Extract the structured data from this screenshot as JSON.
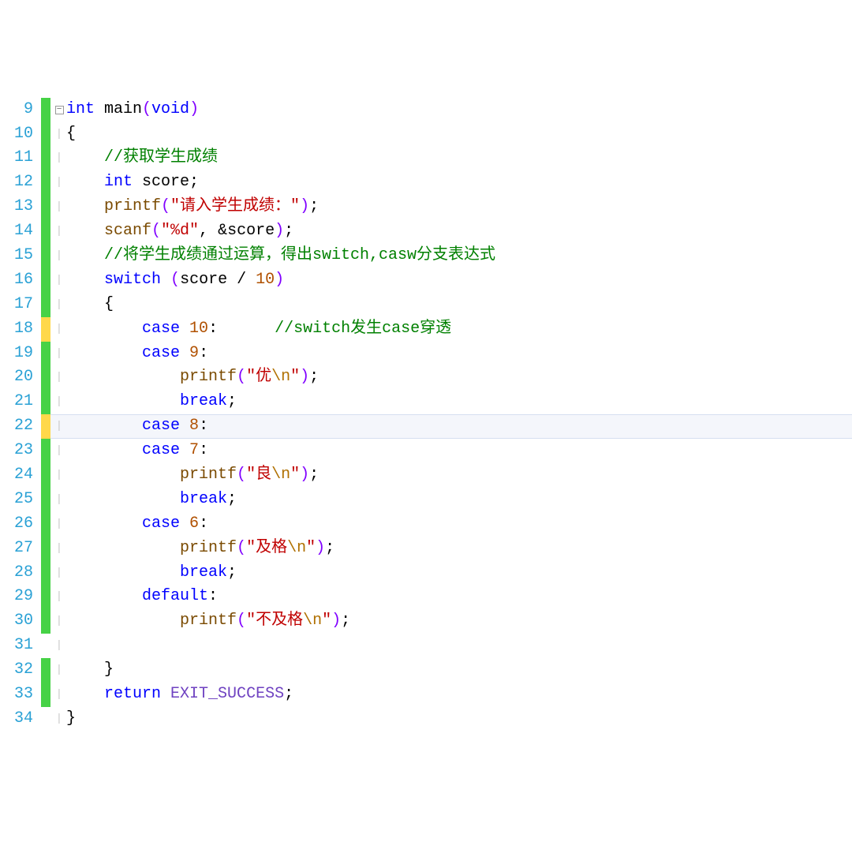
{
  "startLine": 9,
  "highlightLine": 22,
  "markers": [
    {
      "line": 9,
      "color": "green",
      "fold": "minus"
    },
    {
      "line": 10,
      "color": "green"
    },
    {
      "line": 11,
      "color": "green"
    },
    {
      "line": 12,
      "color": "green"
    },
    {
      "line": 13,
      "color": "green"
    },
    {
      "line": 14,
      "color": "green"
    },
    {
      "line": 15,
      "color": "green"
    },
    {
      "line": 16,
      "color": "green",
      "fold": "minus",
      "foldIndent": true
    },
    {
      "line": 17,
      "color": "green"
    },
    {
      "line": 18,
      "color": "yellow"
    },
    {
      "line": 19,
      "color": "green"
    },
    {
      "line": 20,
      "color": "green"
    },
    {
      "line": 21,
      "color": "green"
    },
    {
      "line": 22,
      "color": "yellow"
    },
    {
      "line": 23,
      "color": "green"
    },
    {
      "line": 24,
      "color": "green"
    },
    {
      "line": 25,
      "color": "green"
    },
    {
      "line": 26,
      "color": "green"
    },
    {
      "line": 27,
      "color": "green"
    },
    {
      "line": 28,
      "color": "green"
    },
    {
      "line": 29,
      "color": "green"
    },
    {
      "line": 30,
      "color": "green"
    },
    {
      "line": 32,
      "color": "green"
    },
    {
      "line": 33,
      "color": "green"
    }
  ],
  "tokens": {
    "l9": [
      {
        "t": "int ",
        "c": "type"
      },
      {
        "t": "main",
        "c": "identdark"
      },
      {
        "t": "(",
        "c": "paren"
      },
      {
        "t": "void",
        "c": "type"
      },
      {
        "t": ")",
        "c": "paren"
      }
    ],
    "l10": [
      {
        "t": "{",
        "c": "black"
      }
    ],
    "l11": [
      {
        "t": "    ",
        "c": ""
      },
      {
        "t": "//获取学生成绩",
        "c": "cmt"
      }
    ],
    "l12": [
      {
        "t": "    ",
        "c": ""
      },
      {
        "t": "int ",
        "c": "type"
      },
      {
        "t": "score",
        "c": "identdark"
      },
      {
        "t": ";",
        "c": "black"
      }
    ],
    "l13": [
      {
        "t": "    ",
        "c": ""
      },
      {
        "t": "printf",
        "c": "ident"
      },
      {
        "t": "(",
        "c": "paren"
      },
      {
        "t": "\"请入学生成绩：\"",
        "c": "str"
      },
      {
        "t": ")",
        "c": "paren"
      },
      {
        "t": ";",
        "c": "black"
      }
    ],
    "l14": [
      {
        "t": "    ",
        "c": ""
      },
      {
        "t": "scanf",
        "c": "ident"
      },
      {
        "t": "(",
        "c": "paren"
      },
      {
        "t": "\"%d\"",
        "c": "str"
      },
      {
        "t": ", &",
        "c": "black"
      },
      {
        "t": "score",
        "c": "identdark"
      },
      {
        "t": ")",
        "c": "paren"
      },
      {
        "t": ";",
        "c": "black"
      }
    ],
    "l15": [
      {
        "t": "    ",
        "c": ""
      },
      {
        "t": "//将学生成绩通过运算，得出switch,casw分支表达式",
        "c": "cmt"
      }
    ],
    "l16": [
      {
        "t": "    ",
        "c": ""
      },
      {
        "t": "switch",
        "c": "kw"
      },
      {
        "t": " ",
        "c": ""
      },
      {
        "t": "(",
        "c": "paren"
      },
      {
        "t": "score ",
        "c": "identdark"
      },
      {
        "t": "/",
        "c": "black"
      },
      {
        "t": " ",
        "c": ""
      },
      {
        "t": "10",
        "c": "num"
      },
      {
        "t": ")",
        "c": "paren"
      }
    ],
    "l17": [
      {
        "t": "    {",
        "c": "black"
      }
    ],
    "l18": [
      {
        "t": "        ",
        "c": ""
      },
      {
        "t": "case",
        "c": "kw"
      },
      {
        "t": " ",
        "c": ""
      },
      {
        "t": "10",
        "c": "num"
      },
      {
        "t": ":",
        "c": "black"
      },
      {
        "t": "      ",
        "c": ""
      },
      {
        "t": "//switch发生case穿透",
        "c": "cmt"
      }
    ],
    "l19": [
      {
        "t": "        ",
        "c": ""
      },
      {
        "t": "case",
        "c": "kw"
      },
      {
        "t": " ",
        "c": ""
      },
      {
        "t": "9",
        "c": "num"
      },
      {
        "t": ":",
        "c": "black"
      }
    ],
    "l20": [
      {
        "t": "            ",
        "c": ""
      },
      {
        "t": "printf",
        "c": "ident"
      },
      {
        "t": "(",
        "c": "paren"
      },
      {
        "t": "\"优",
        "c": "str"
      },
      {
        "t": "\\n",
        "c": "esc"
      },
      {
        "t": "\"",
        "c": "str"
      },
      {
        "t": ")",
        "c": "paren"
      },
      {
        "t": ";",
        "c": "black"
      }
    ],
    "l21": [
      {
        "t": "            ",
        "c": ""
      },
      {
        "t": "break",
        "c": "kw"
      },
      {
        "t": ";",
        "c": "black"
      }
    ],
    "l22": [
      {
        "t": "        ",
        "c": ""
      },
      {
        "t": "case",
        "c": "kw"
      },
      {
        "t": " ",
        "c": ""
      },
      {
        "t": "8",
        "c": "num"
      },
      {
        "t": ":",
        "c": "black"
      }
    ],
    "l23": [
      {
        "t": "        ",
        "c": ""
      },
      {
        "t": "case",
        "c": "kw"
      },
      {
        "t": " ",
        "c": ""
      },
      {
        "t": "7",
        "c": "num"
      },
      {
        "t": ":",
        "c": "black"
      }
    ],
    "l24": [
      {
        "t": "            ",
        "c": ""
      },
      {
        "t": "printf",
        "c": "ident"
      },
      {
        "t": "(",
        "c": "paren"
      },
      {
        "t": "\"良",
        "c": "str"
      },
      {
        "t": "\\n",
        "c": "esc"
      },
      {
        "t": "\"",
        "c": "str"
      },
      {
        "t": ")",
        "c": "paren"
      },
      {
        "t": ";",
        "c": "black"
      }
    ],
    "l25": [
      {
        "t": "            ",
        "c": ""
      },
      {
        "t": "break",
        "c": "kw"
      },
      {
        "t": ";",
        "c": "black"
      }
    ],
    "l26": [
      {
        "t": "        ",
        "c": ""
      },
      {
        "t": "case",
        "c": "kw"
      },
      {
        "t": " ",
        "c": ""
      },
      {
        "t": "6",
        "c": "num"
      },
      {
        "t": ":",
        "c": "black"
      }
    ],
    "l27": [
      {
        "t": "            ",
        "c": ""
      },
      {
        "t": "printf",
        "c": "ident"
      },
      {
        "t": "(",
        "c": "paren"
      },
      {
        "t": "\"及格",
        "c": "str"
      },
      {
        "t": "\\n",
        "c": "esc"
      },
      {
        "t": "\"",
        "c": "str"
      },
      {
        "t": ")",
        "c": "paren"
      },
      {
        "t": ";",
        "c": "black"
      }
    ],
    "l28": [
      {
        "t": "            ",
        "c": ""
      },
      {
        "t": "break",
        "c": "kw"
      },
      {
        "t": ";",
        "c": "black"
      }
    ],
    "l29": [
      {
        "t": "        ",
        "c": ""
      },
      {
        "t": "default",
        "c": "kw"
      },
      {
        "t": ":",
        "c": "black"
      }
    ],
    "l30": [
      {
        "t": "            ",
        "c": ""
      },
      {
        "t": "printf",
        "c": "ident"
      },
      {
        "t": "(",
        "c": "paren"
      },
      {
        "t": "\"不及格",
        "c": "str"
      },
      {
        "t": "\\n",
        "c": "esc"
      },
      {
        "t": "\"",
        "c": "str"
      },
      {
        "t": ")",
        "c": "paren"
      },
      {
        "t": ";",
        "c": "black"
      }
    ],
    "l31": [
      {
        "t": " ",
        "c": ""
      }
    ],
    "l32": [
      {
        "t": "    }",
        "c": "black"
      }
    ],
    "l33": [
      {
        "t": "    ",
        "c": ""
      },
      {
        "t": "return",
        "c": "kw"
      },
      {
        "t": " ",
        "c": ""
      },
      {
        "t": "EXIT_SUCCESS",
        "c": "macro"
      },
      {
        "t": ";",
        "c": "black"
      }
    ],
    "l34": [
      {
        "t": "}",
        "c": "black"
      }
    ]
  }
}
